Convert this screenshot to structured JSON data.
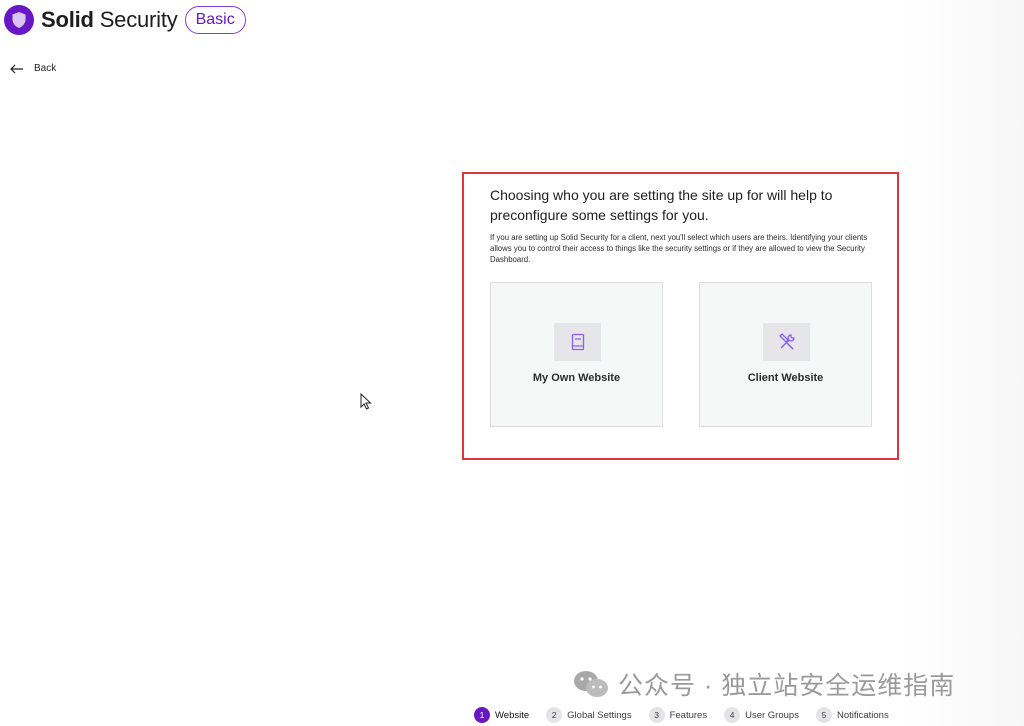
{
  "header": {
    "logo_bold": "Solid",
    "logo_light": "Security",
    "plan_badge": "Basic"
  },
  "nav": {
    "back_label": "Back"
  },
  "intro": {
    "title": "Choosing who you are setting the site up for will help to preconfigure some settings for you.",
    "description": "If you are setting up Solid Security for a client, next you'll select which users are theirs. Identifying your clients allows you to control their access to things like the security settings or if they are allowed to view the Security Dashboard."
  },
  "choices": [
    {
      "label": "My Own Website",
      "icon": "book-icon"
    },
    {
      "label": "Client Website",
      "icon": "tools-icon"
    }
  ],
  "stepper": [
    {
      "num": "1",
      "label": "Website",
      "active": true
    },
    {
      "num": "2",
      "label": "Global Settings",
      "active": false
    },
    {
      "num": "3",
      "label": "Features",
      "active": false
    },
    {
      "num": "4",
      "label": "User Groups",
      "active": false
    },
    {
      "num": "5",
      "label": "Notifications",
      "active": false
    }
  ],
  "watermark": "公众号 · 独立站安全运维指南",
  "colors": {
    "brand_purple": "#6817c5",
    "highlight_red": "#e0353b",
    "card_bg": "#f6f7f7"
  }
}
